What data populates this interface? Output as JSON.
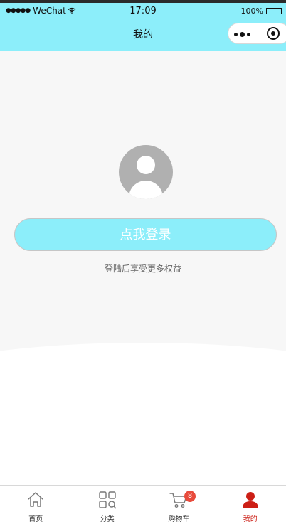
{
  "status_bar": {
    "signal": "●●●●●",
    "carrier": "WeChat",
    "time": "17:09",
    "battery": "100%",
    "icons": [
      "wifi-icon",
      "battery-icon"
    ]
  },
  "nav": {
    "title": "我的",
    "capsule_icons": [
      "more-icon",
      "close-icon"
    ]
  },
  "profile": {
    "avatar_icon": "avatar-icon",
    "login_label": "点我登录",
    "hint": "登陆后享受更多权益"
  },
  "tabs": [
    {
      "label": "首页",
      "icon": "home-icon",
      "active": false
    },
    {
      "label": "分类",
      "icon": "category-icon",
      "active": false
    },
    {
      "label": "购物车",
      "icon": "cart-icon",
      "badge": "8",
      "active": false
    },
    {
      "label": "我的",
      "icon": "user-icon",
      "active": true
    }
  ],
  "colors": {
    "header_bg": "#8ceefa",
    "page_bg": "#f7f7f7",
    "active_tab": "#cc1f16",
    "badge": "#e84b3c"
  }
}
